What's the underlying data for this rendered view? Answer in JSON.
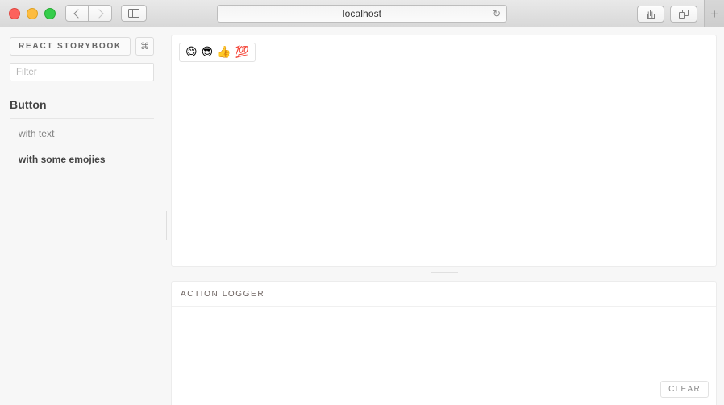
{
  "browser": {
    "title": "localhost",
    "address_value": "localhost",
    "reload_icon": "↻",
    "back_icon": "chevron-left-icon",
    "forward_icon": "chevron-right-icon",
    "sidebar_toggle_icon": "sidebar-icon",
    "share_icon": "share-icon",
    "tabs_icon": "tabs-icon",
    "new_tab_label": "+",
    "traffic_lights": [
      "close",
      "minimize",
      "maximize"
    ]
  },
  "sidebar": {
    "brand_label": "REACT STORYBOOK",
    "shortcut_label": "⌘",
    "filter_placeholder": "Filter",
    "filter_value": "",
    "kinds": [
      {
        "title": "Button",
        "stories": [
          {
            "label": "with text",
            "selected": false
          },
          {
            "label": "with some emojies",
            "selected": true
          }
        ]
      }
    ]
  },
  "preview": {
    "button": {
      "emojis": [
        "😄",
        "😎",
        "👍",
        "💯"
      ]
    }
  },
  "logger": {
    "title": "ACTION LOGGER",
    "entries": [],
    "clear_label": "CLEAR"
  },
  "colors": {
    "app_background": "#f7f7f7",
    "panel_background": "#ffffff",
    "panel_border": "#ececec",
    "text_primary": "#444444",
    "text_muted": "#828282",
    "traffic_close": "#fc625d",
    "traffic_min": "#fdbc40",
    "traffic_max": "#35cd4b"
  }
}
